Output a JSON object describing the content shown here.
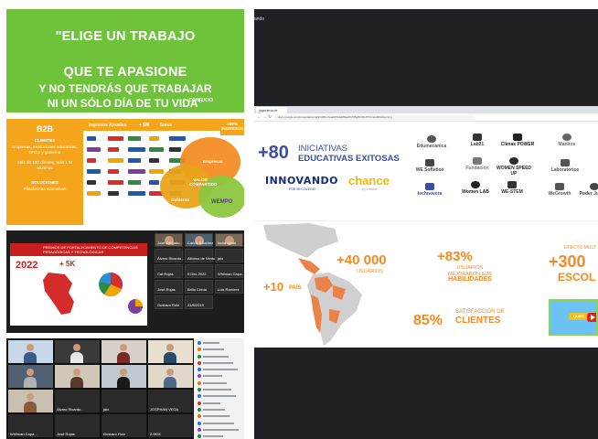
{
  "quote_slide": {
    "line1": "\"ELIGE UN TRABAJO",
    "line2": "QUE TE APASIONE",
    "line3": "Y NO TENDRÁS QUE TRABAJAR",
    "line4": "NI UN SÓLO DÍA DE TU VIDA\"",
    "author": "- CONFUCIO"
  },
  "b2b_slide": {
    "title": "B2B",
    "clients_label": "CLIENTES",
    "clients_text": "Empresas, instituciones educativas, ONGs y gobierno",
    "stat_text": "Más de 100 clientes, más 1 M alumnos",
    "solutions_label": "SOLUCIONES",
    "solutions_text": "Plataformas educativas",
    "revenue_label": "Ingresos Anuales",
    "revenue_value": "+ 5M",
    "revenue_unit": "Soles",
    "top_right": "+60% INGRESOS",
    "venn_orange": "Empresas",
    "venn_green": "VALOR COMPARTIDO",
    "venn_yellow": "Gobierno",
    "venn_wempo": "WEMPO",
    "logo_colors": [
      "#1e5aa8",
      "#d62f2f",
      "#2d8a3e",
      "#f0a500",
      "#1e5aa8",
      "#7b3fa0",
      "#d62f2f",
      "#1e5aa8",
      "#2d8a3e",
      "#333333",
      "#d62f2f",
      "#f0a500",
      "#1e5aa8",
      "#333333",
      "#2d8a3e",
      "#1e5aa8",
      "#d62f2f",
      "#7b3fa0",
      "#f0a500",
      "#1e5aa8",
      "#333333",
      "#d62f2f",
      "#2d8a3e",
      "#1e5aa8",
      "#d62f2f",
      "#f0a500",
      "#333333",
      "#1e5aa8",
      "#d62f2f",
      "#2d8a3e"
    ]
  },
  "zoom_top": {
    "slide_header": "PREMIOS DE FORTALECIMIENTO DE COMPETENCIAS PEDAGÓGICAS Y TECNOLÓGICAS",
    "slide_year": "2022",
    "slide_plus": "+ 5K",
    "participants": [
      "José Delgado",
      "Carlos Sánchez",
      "lucila ojeda",
      "Álvaro Ricardo...",
      "Alfonso de Ventura",
      "jaio",
      "Cat Rojas",
      "9 Dec 2022",
      "Whilman Capa...",
      "José Rojas",
      "Brillo Cerda",
      "Luis Ramírez",
      "Gustavo Ruiz",
      "21/8/2019"
    ]
  },
  "zoom_bottom": {
    "participants": [
      "",
      "",
      "",
      "",
      "",
      "",
      "",
      "",
      "",
      "Álvaro Ricardo...",
      "jaio",
      "JOSPHAN VEGA",
      "Whilman Capa...",
      "José Rojas",
      "Gustavo Ruiz",
      "2.9KM"
    ],
    "chat_colors": [
      "#1a73e8",
      "#e8710a",
      "#1e8e3e",
      "#d93025",
      "#1a73e8",
      "#9334e6",
      "#e8710a",
      "#1e8e3e",
      "#1a73e8",
      "#d93025",
      "#1e8e3e",
      "#e8710a",
      "#1a73e8",
      "#9334e6",
      "#1e8e3e",
      "#d93025"
    ]
  },
  "window_top": {
    "label": "ando"
  },
  "browser": {
    "tab_label": "Ingeniería de Tapper",
    "url": "docs.google.com/presentation/d/1Vr3IKmSoabP4HeM8aeRU5f5g8zOFHTXzm/edit#slide=id.p"
  },
  "stats_slide": {
    "big_number": "+80",
    "initiatives_line1": "INICIATIVAS",
    "initiatives_line2": "EDUCATIVAS EXITOSAS",
    "innovando": "INNOVANDO",
    "innovando_sub": "POR MI COLEGIO",
    "chance": "chance",
    "chance_sub": "by Chance",
    "partner_logos": [
      "Edumecanica",
      "Lab21",
      "Clímax POWER",
      "Manitos",
      "WE Sofisticó",
      "Fundación",
      "WOMEN SPEED UP",
      "Laboratorios",
      "technovera",
      "Women LAB",
      "WE-STEM",
      "WeGrowth",
      "Poder Juvenil"
    ],
    "countries_value": "+10",
    "countries_label": "PAÍS",
    "users_value": "+40 000",
    "users_label": "USUARIOS",
    "improved_value": "+83%",
    "improved_line1": "USUARIOS",
    "improved_line2": "MEJORARON SUS",
    "improved_line3": "HABILIDADES",
    "satisfaction_value": "85%",
    "satisfaction_line1": "SATISFACCIÓN DE",
    "satisfaction_line2": "CLIENTES",
    "effect_label": "EFECTO MULT",
    "schools_value": "+300",
    "schools_label": "ESCOL",
    "video_badge": "QUIET"
  },
  "colors": {
    "quote_green": "#6fc33a",
    "b2b_orange": "#f5a51b",
    "stat_orange": "#f58a1f",
    "brand_blue": "#3a4fa0",
    "dark_bg": "#202124"
  }
}
